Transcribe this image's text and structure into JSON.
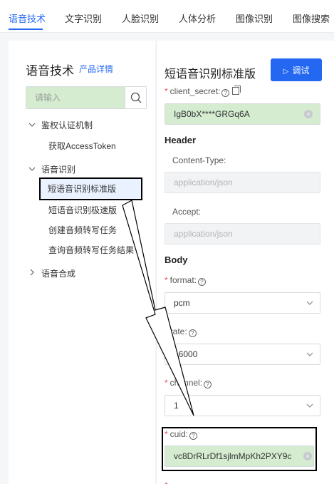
{
  "tabs": [
    "语音技术",
    "文字识别",
    "人脸识别",
    "人体分析",
    "图像识别",
    "图像搜索"
  ],
  "sidebar": {
    "title": "语音技术",
    "detail_link": "产品详情",
    "search_placeholder": "请输入",
    "groups": [
      {
        "label": "鉴权认证机制",
        "items": [
          "获取AccessToken"
        ]
      },
      {
        "label": "语音识别",
        "items": [
          "短语音识别标准版",
          "短语音识别极速版",
          "创建音频转写任务",
          "查询音频转写任务结果"
        ]
      },
      {
        "label": "语音合成",
        "items": []
      }
    ]
  },
  "main": {
    "title": "短语音识别标准版",
    "debug_button": "调试",
    "client_secret_label": "client_secret:",
    "client_secret_value": "IgB0bX****GRGq6A",
    "header_section": "Header",
    "content_type_label": "Content-Type:",
    "content_type_placeholder": "application/json",
    "accept_label": "Accept:",
    "accept_placeholder": "application/json",
    "body_section": "Body",
    "format_label": "format:",
    "format_value": "pcm",
    "rate_label": "rate:",
    "rate_value": "16000",
    "channel_label": "channel:",
    "channel_value": "1",
    "cuid_label": "cuid:",
    "cuid_value": "vc8DrRLrDf1sjlmMpKh2PXY9c"
  },
  "colors": {
    "accent": "#2468f2",
    "highlight_green": "#d5ecd1",
    "required": "#e34d59"
  }
}
